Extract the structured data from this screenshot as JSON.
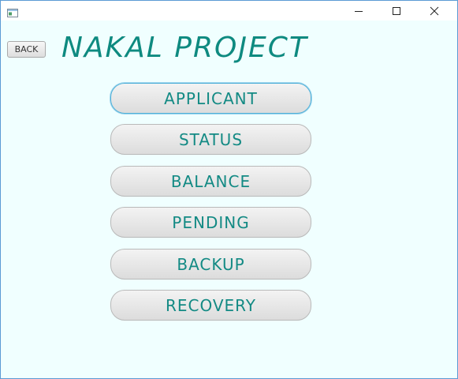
{
  "window": {
    "title": "",
    "controls": [
      "minimize",
      "maximize",
      "close"
    ]
  },
  "header": {
    "back_label": "BACK",
    "title": "NAKAL PROJECT"
  },
  "menu": {
    "buttons": [
      {
        "label": "APPLICANT",
        "focused": true
      },
      {
        "label": "STATUS",
        "focused": false
      },
      {
        "label": "BALANCE",
        "focused": false
      },
      {
        "label": "PENDING",
        "focused": false
      },
      {
        "label": "BACKUP",
        "focused": false
      },
      {
        "label": "RECOVERY",
        "focused": false
      }
    ]
  },
  "colors": {
    "background": "#f0ffff",
    "accent_text": "#138a84",
    "focus_border": "#4fb0d8"
  }
}
